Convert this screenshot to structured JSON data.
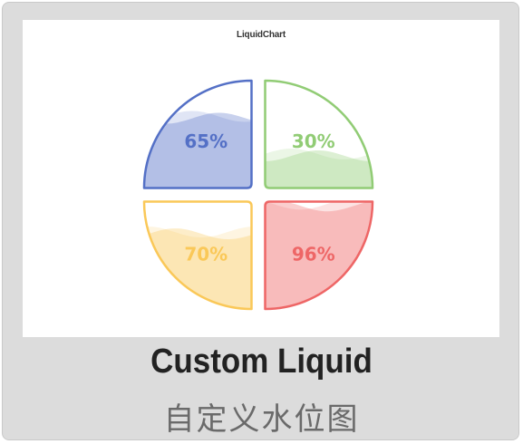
{
  "card": {
    "title": "Custom Liquid",
    "subtitle": "自定义水位图"
  },
  "chart_data": {
    "type": "liquid",
    "title": "LiquidChart",
    "series": [
      {
        "value": 0.65,
        "label": "65%",
        "color": "#5470c6"
      },
      {
        "value": 0.3,
        "label": "30%",
        "color": "#91cc75"
      },
      {
        "value": 0.7,
        "label": "70%",
        "color": "#fac858"
      },
      {
        "value": 0.96,
        "label": "96%",
        "color": "#ee6666"
      }
    ]
  }
}
